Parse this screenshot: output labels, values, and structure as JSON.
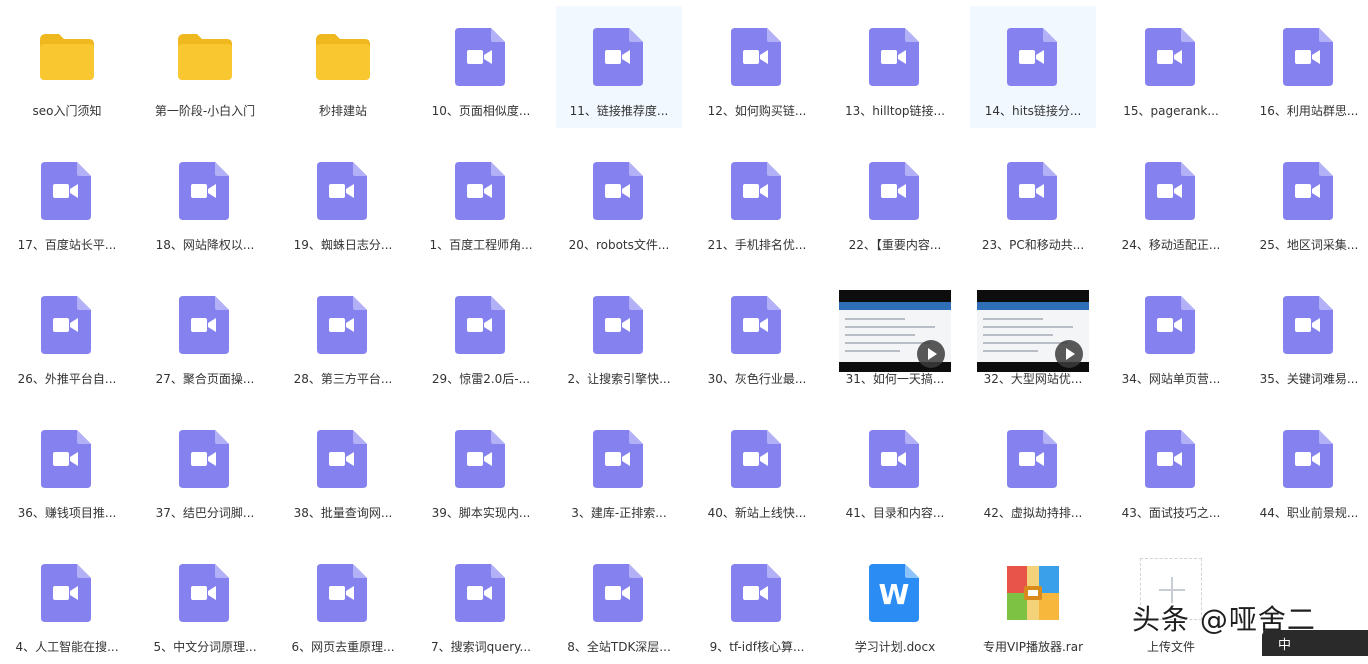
{
  "colors": {
    "folder": "#f9c830",
    "folder_tab": "#f0b81f",
    "video": "#8582f0",
    "video_fold": "#b2b0f7",
    "word": "#2b8cf3",
    "selected_bg": "#f2f8ff"
  },
  "files": [
    {
      "label": "seo入门须知",
      "type": "folder",
      "icon": "folder-icon"
    },
    {
      "label": "第一阶段-小白入门",
      "type": "folder",
      "icon": "folder-icon"
    },
    {
      "label": "秒排建站",
      "type": "folder",
      "icon": "folder-icon"
    },
    {
      "label": "10、页面相似度...",
      "type": "video",
      "icon": "video-file-icon"
    },
    {
      "label": "11、链接推荐度...",
      "type": "video",
      "icon": "video-file-icon",
      "selected": true
    },
    {
      "label": "12、如何购买链...",
      "type": "video",
      "icon": "video-file-icon"
    },
    {
      "label": "13、hilltop链接...",
      "type": "video",
      "icon": "video-file-icon"
    },
    {
      "label": "14、hits链接分...",
      "type": "video",
      "icon": "video-file-icon",
      "selected": true
    },
    {
      "label": "15、pagerank...",
      "type": "video",
      "icon": "video-file-icon"
    },
    {
      "label": "16、利用站群思...",
      "type": "video",
      "icon": "video-file-icon"
    },
    {
      "label": "17、百度站长平...",
      "type": "video",
      "icon": "video-file-icon"
    },
    {
      "label": "18、网站降权以...",
      "type": "video",
      "icon": "video-file-icon"
    },
    {
      "label": "19、蜘蛛日志分...",
      "type": "video",
      "icon": "video-file-icon"
    },
    {
      "label": "1、百度工程师角...",
      "type": "video",
      "icon": "video-file-icon"
    },
    {
      "label": "20、robots文件...",
      "type": "video",
      "icon": "video-file-icon"
    },
    {
      "label": "21、手机排名优...",
      "type": "video",
      "icon": "video-file-icon"
    },
    {
      "label": "22、【重要内容...",
      "type": "video",
      "icon": "video-file-icon"
    },
    {
      "label": "23、PC和移动共...",
      "type": "video",
      "icon": "video-file-icon"
    },
    {
      "label": "24、移动适配正...",
      "type": "video",
      "icon": "video-file-icon"
    },
    {
      "label": "25、地区词采集...",
      "type": "video",
      "icon": "video-file-icon"
    },
    {
      "label": "26、外推平台自...",
      "type": "video",
      "icon": "video-file-icon"
    },
    {
      "label": "27、聚合页面操...",
      "type": "video",
      "icon": "video-file-icon"
    },
    {
      "label": "28、第三方平台...",
      "type": "video",
      "icon": "video-file-icon"
    },
    {
      "label": "29、惊雷2.0后-...",
      "type": "video",
      "icon": "video-file-icon"
    },
    {
      "label": "2、让搜索引擎快...",
      "type": "video",
      "icon": "video-file-icon"
    },
    {
      "label": "30、灰色行业最...",
      "type": "video",
      "icon": "video-file-icon"
    },
    {
      "label": "31、如何一天搞...",
      "type": "thumbnail",
      "icon": "video-thumbnail"
    },
    {
      "label": "32、大型网站优...",
      "type": "thumbnail",
      "icon": "video-thumbnail"
    },
    {
      "label": "34、网站单页营...",
      "type": "video",
      "icon": "video-file-icon"
    },
    {
      "label": "35、关键词难易...",
      "type": "video",
      "icon": "video-file-icon"
    },
    {
      "label": "36、赚钱项目推...",
      "type": "video",
      "icon": "video-file-icon"
    },
    {
      "label": "37、结巴分词脚...",
      "type": "video",
      "icon": "video-file-icon"
    },
    {
      "label": "38、批量查询网...",
      "type": "video",
      "icon": "video-file-icon"
    },
    {
      "label": "39、脚本实现内...",
      "type": "video",
      "icon": "video-file-icon"
    },
    {
      "label": "3、建库-正排索...",
      "type": "video",
      "icon": "video-file-icon"
    },
    {
      "label": "40、新站上线快...",
      "type": "video",
      "icon": "video-file-icon"
    },
    {
      "label": "41、目录和内容...",
      "type": "video",
      "icon": "video-file-icon"
    },
    {
      "label": "42、虚拟劫持排...",
      "type": "video",
      "icon": "video-file-icon"
    },
    {
      "label": "43、面试技巧之...",
      "type": "video",
      "icon": "video-file-icon"
    },
    {
      "label": "44、职业前景规...",
      "type": "video",
      "icon": "video-file-icon"
    },
    {
      "label": "4、人工智能在搜...",
      "type": "video",
      "icon": "video-file-icon"
    },
    {
      "label": "5、中文分词原理...",
      "type": "video",
      "icon": "video-file-icon"
    },
    {
      "label": "6、网页去重原理...",
      "type": "video",
      "icon": "video-file-icon"
    },
    {
      "label": "7、搜索词query...",
      "type": "video",
      "icon": "video-file-icon"
    },
    {
      "label": "8、全站TDK深层...",
      "type": "video",
      "icon": "video-file-icon"
    },
    {
      "label": "9、tf-idf核心算...",
      "type": "video",
      "icon": "video-file-icon"
    },
    {
      "label": "学习计划.docx",
      "type": "word",
      "icon": "word-doc-icon",
      "glyph": "W"
    },
    {
      "label": "专用VIP播放器.rar",
      "type": "rar",
      "icon": "rar-archive-icon"
    },
    {
      "label": "上传文件",
      "type": "upload",
      "icon": "upload-plus-icon"
    }
  ],
  "watermark": {
    "text": "头条 @哑舍二"
  },
  "corner_badge": {
    "text": "中"
  }
}
